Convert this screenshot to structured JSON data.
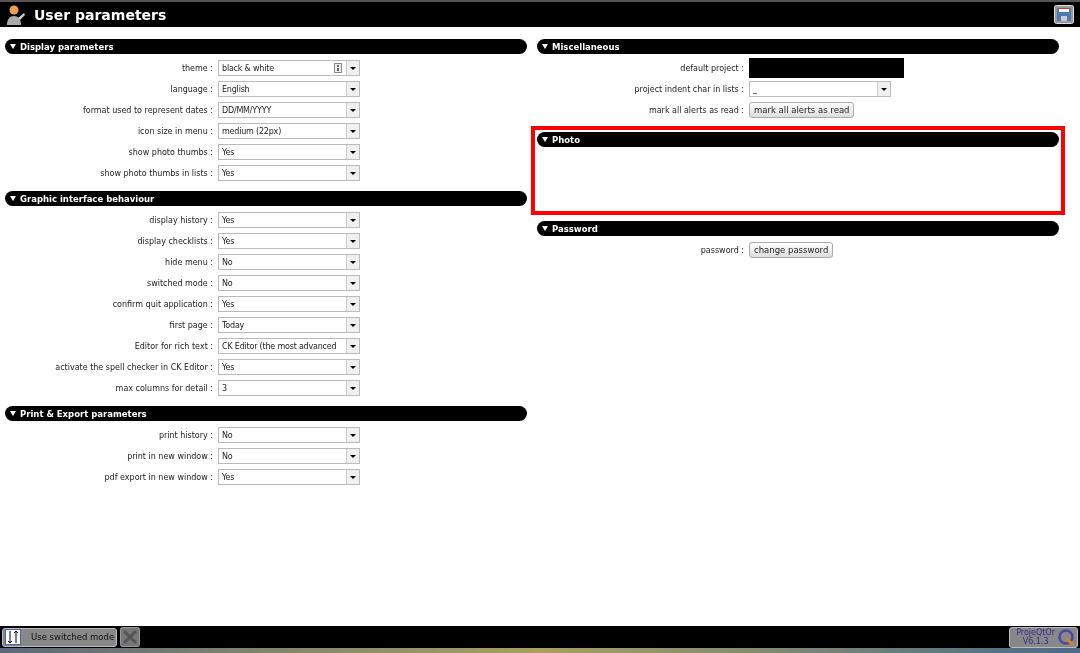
{
  "window": {
    "title": "User parameters"
  },
  "columns": [
    [
      {
        "title": "Display parameters",
        "highlighted": false,
        "rows": [
          {
            "label": "theme :",
            "kind": "select-extra",
            "value": "black & white"
          },
          {
            "label": "language :",
            "kind": "select",
            "value": "English"
          },
          {
            "label": "format used to represent dates :",
            "kind": "select",
            "value": "DD/MM/YYYY"
          },
          {
            "label": "icon size in menu :",
            "kind": "select",
            "value": "medium (22px)"
          },
          {
            "label": "show photo thumbs :",
            "kind": "select",
            "value": "Yes"
          },
          {
            "label": "show photo thumbs in lists :",
            "kind": "select",
            "value": "Yes"
          }
        ]
      },
      {
        "title": "Graphic interface behaviour",
        "highlighted": false,
        "rows": [
          {
            "label": "display history :",
            "kind": "select",
            "value": "Yes"
          },
          {
            "label": "display checklists :",
            "kind": "select",
            "value": "Yes"
          },
          {
            "label": "hide menu :",
            "kind": "select",
            "value": "No"
          },
          {
            "label": "switched mode :",
            "kind": "select",
            "value": "No"
          },
          {
            "label": "confirm quit application :",
            "kind": "select",
            "value": "Yes"
          },
          {
            "label": "first page :",
            "kind": "select",
            "value": "Today"
          },
          {
            "label": "Editor for rich text :",
            "kind": "select",
            "value": "CK Editor (the most advanced"
          },
          {
            "label": "activate the spell checker in CK Editor :",
            "kind": "select",
            "value": "Yes"
          },
          {
            "label": "max columns for detail :",
            "kind": "select",
            "value": "3"
          }
        ]
      },
      {
        "title": "Print & Export parameters",
        "highlighted": false,
        "rows": [
          {
            "label": "print history :",
            "kind": "select",
            "value": "No"
          },
          {
            "label": "print in new window :",
            "kind": "select",
            "value": "No"
          },
          {
            "label": "pdf export in new window :",
            "kind": "select",
            "value": "Yes"
          }
        ]
      }
    ],
    [
      {
        "title": "Miscellaneous",
        "highlighted": false,
        "rows": [
          {
            "label": "default project :",
            "kind": "redacted"
          },
          {
            "label": "project indent char in lists :",
            "kind": "select",
            "value": "_"
          },
          {
            "label": "mark all alerts as read :",
            "kind": "button",
            "value": "mark all alerts as read"
          }
        ]
      },
      {
        "title": "Photo",
        "highlighted": true
      },
      {
        "title": "Password",
        "highlighted": false,
        "rows": [
          {
            "label": "password :",
            "kind": "button",
            "value": "change password"
          }
        ]
      }
    ]
  ],
  "footer": {
    "switch_button": "Use switched mode",
    "version_name": "ProjeQtOr",
    "version": "V6.1.3"
  }
}
